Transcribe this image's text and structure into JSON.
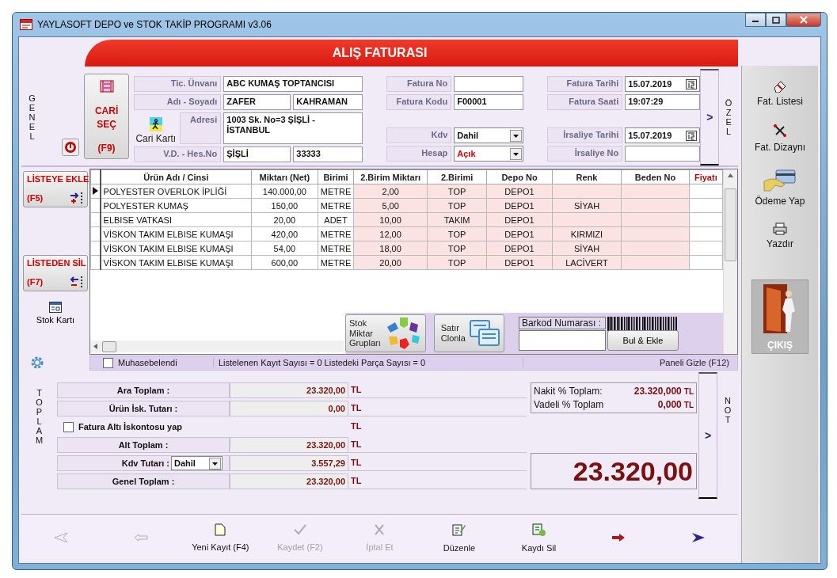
{
  "window": {
    "title": "YAYLASOFT DEPO ve STOK TAKİP PROGRAMI v3.06"
  },
  "header": {
    "title": "ALIŞ FATURASI"
  },
  "general": {
    "side_label": "GENEL",
    "cari_button": {
      "line1": "CARİ",
      "line2": "SEÇ",
      "key": "(F9)"
    },
    "cari_card": "Cari Kartı",
    "customer": {
      "title": {
        "label": "Tic. Ünvanı",
        "value": "ABC KUMAŞ TOPTANCISI"
      },
      "name": {
        "label": "Adı  - Soyadı",
        "first": "ZAFER",
        "last": "KAHRAMAN"
      },
      "address": {
        "label": "Adresi",
        "value": "1003 Sk. No=3 ŞİŞLİ - İSTANBUL"
      },
      "tax": {
        "label": "V.D. - Hes.No",
        "office": "ŞİŞLİ",
        "number": "33333"
      }
    },
    "invoice": {
      "number": {
        "label": "Fatura No"
      },
      "code": {
        "label": "Fatura Kodu",
        "value": "F00001"
      },
      "kdv": {
        "label": "Kdv",
        "value": "Dahil"
      },
      "account": {
        "label": "Hesap",
        "value": "Açık"
      }
    },
    "dates": {
      "invoice_date": {
        "label": "Fatura Tarihi",
        "value": "15.07.2019"
      },
      "invoice_time": {
        "label": "Fatura Saati",
        "value": "19:07:29"
      },
      "waybill_date": {
        "label": "İrsaliye Tarihi",
        "value": "15.07.2019"
      },
      "waybill_no": {
        "label": "İrsaliye No"
      }
    },
    "special": {
      "arrow": ">",
      "label": "ÖZEL"
    }
  },
  "list_tools": {
    "add": {
      "label": "LİSTEYE EKLE",
      "key": "(F5)"
    },
    "remove": {
      "label": "LİSTEDEN SİL",
      "key": "(F7)"
    },
    "stock_card": "Stok Kartı"
  },
  "table": {
    "columns": [
      {
        "label": "Ürün Adı / Cinsi",
        "shaded": false,
        "emphasis": false
      },
      {
        "label": "Miktarı (Net)",
        "shaded": false,
        "emphasis": false
      },
      {
        "label": "Birimi",
        "shaded": false,
        "emphasis": false
      },
      {
        "label": "2.Birim Miktarı",
        "shaded": true,
        "emphasis": false
      },
      {
        "label": "2.Birimi",
        "shaded": true,
        "emphasis": false
      },
      {
        "label": "Depo No",
        "shaded": true,
        "emphasis": false
      },
      {
        "label": "Renk",
        "shaded": true,
        "emphasis": false
      },
      {
        "label": "Beden No",
        "shaded": true,
        "emphasis": false
      },
      {
        "label": "Fiyatı",
        "shaded": false,
        "emphasis": true
      }
    ],
    "rows": [
      {
        "selected": true,
        "product": "POLYESTER OVERLOK İPLİĞİ",
        "quantity": "140.000,00",
        "unit": "METRE",
        "quantity_2": "2,00",
        "unit_2": "TOP",
        "depot": "DEPO1"
      },
      {
        "selected": false,
        "product": "POLYESTER KUMAŞ",
        "quantity": "150,00",
        "unit": "METRE",
        "quantity_2": "5,00",
        "unit_2": "TOP",
        "depot": "DEPO1",
        "colour": "SİYAH"
      },
      {
        "selected": false,
        "product": "ELBISE VATKASI",
        "quantity": "20,00",
        "unit": "ADET",
        "quantity_2": "10,00",
        "unit_2": "TAKIM",
        "depot": "DEPO1"
      },
      {
        "selected": false,
        "product": "VİSKON TAKIM ELBISE KUMAŞI",
        "quantity": "420,00",
        "unit": "METRE",
        "quantity_2": "12,00",
        "unit_2": "TOP",
        "depot": "DEPO1",
        "colour": "KIRMIZI"
      },
      {
        "selected": false,
        "product": "VİSKON TAKIM ELBISE KUMAŞI",
        "quantity": "54,00",
        "unit": "METRE",
        "quantity_2": "18,00",
        "unit_2": "TOP",
        "depot": "DEPO1",
        "colour": "SİYAH"
      },
      {
        "selected": false,
        "product": "VİSKON TAKIM ELBISE KUMAŞI",
        "quantity": "600,00",
        "unit": "METRE",
        "quantity_2": "20,00",
        "unit_2": "TOP",
        "depot": "DEPO1",
        "colour": "LACİVERT"
      }
    ],
    "stock_groups": [
      "Stok",
      "Miktar",
      "Grupları"
    ],
    "clone": [
      "Satır",
      "Clonla"
    ],
    "barcode": {
      "label": "Barkod Numarası :",
      "button": "Bul & Ekle"
    }
  },
  "status": {
    "accounted": {
      "label": "Muhasebelendi",
      "checked": false
    },
    "counts": "Listelenen Kayıt Sayısı = 0 Listedeki Parça Sayısı = 0",
    "hide_panel": "Paneli Gizle (F12)"
  },
  "totals": {
    "side_label": "TOPLAM",
    "rows": [
      {
        "kind": "total",
        "label": "Ara Toplam :",
        "value": "23.320,00",
        "currency": "TL"
      },
      {
        "kind": "total",
        "label": "Ürün İsk. Tutarı :",
        "value": "0,00",
        "currency": "TL"
      },
      {
        "kind": "checkbox",
        "label": "Fatura Altı İskontosu yap",
        "checked": false,
        "currency": "TL"
      },
      {
        "kind": "total",
        "label": "Alt Toplam :",
        "value": "23.320,00",
        "currency": "TL"
      },
      {
        "kind": "select",
        "label": "Kdv Tutarı :",
        "option": "Dahil",
        "value": "3.557,29",
        "currency": "TL"
      },
      {
        "kind": "total",
        "label": "Genel Toplam :",
        "value": "23.320,00",
        "currency": "TL"
      }
    ],
    "cash": {
      "label": "Nakit % Toplam:",
      "value": "23.320,000",
      "currency": "TL"
    },
    "credit": {
      "label": "Vadeli % Toplam",
      "value": "0,000",
      "currency": "TL"
    },
    "grand": "23.320,00",
    "note": {
      "arrow": ">",
      "label": "NOT"
    }
  },
  "toolbar": [
    {
      "kind": "first",
      "disabled": true
    },
    {
      "kind": "prev",
      "disabled": true
    },
    {
      "kind": "new",
      "label": "Yeni Kayıt (F4)",
      "disabled": false
    },
    {
      "kind": "save",
      "label": "Kaydet (F2)",
      "disabled": true
    },
    {
      "kind": "cancel",
      "label": "İptal Et",
      "disabled": true
    },
    {
      "kind": "edit",
      "label": "Düzenle",
      "disabled": false
    },
    {
      "kind": "delete",
      "label": "Kaydı Sil",
      "disabled": false
    },
    {
      "kind": "next",
      "disabled": false
    },
    {
      "kind": "last",
      "disabled": false
    }
  ],
  "sidebar": {
    "items": [
      {
        "kind": "list",
        "label": "Fat. Listesi"
      },
      {
        "kind": "design",
        "label": "Fat. Dizaynı"
      },
      {
        "kind": "payment",
        "label": "Ödeme Yap"
      },
      {
        "kind": "print",
        "label": "Yazdır"
      }
    ],
    "exit": "ÇIKIŞ"
  }
}
